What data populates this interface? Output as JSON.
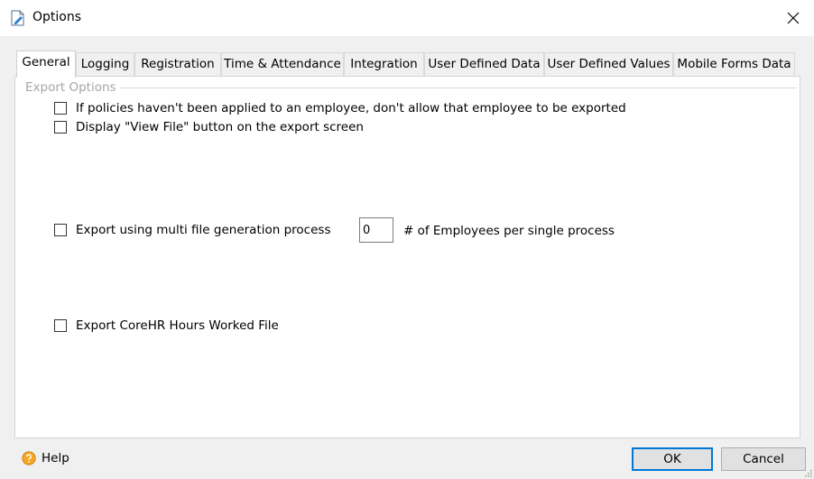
{
  "window": {
    "title": "Options"
  },
  "tabs": [
    {
      "label": "General",
      "active": true
    },
    {
      "label": "Logging"
    },
    {
      "label": "Registration"
    },
    {
      "label": "Time & Attendance"
    },
    {
      "label": "Integration"
    },
    {
      "label": "User Defined Data"
    },
    {
      "label": "User Defined Values"
    },
    {
      "label": "Mobile Forms Data"
    }
  ],
  "export_options": {
    "group_label": "Export Options",
    "no_policy_label": "If policies haven't been applied to an employee, don't allow that employee to be exported",
    "no_policy_checked": false,
    "view_file_label": "Display \"View File\" button on the export screen",
    "view_file_checked": false,
    "multi_file_label": "Export using multi file generation process",
    "multi_file_checked": false,
    "employees_per_process_value": "0",
    "employees_per_process_label": "# of Employees per single process",
    "corehr_label": "Export CoreHR Hours Worked File",
    "corehr_checked": false
  },
  "footer": {
    "help_label": "Help",
    "ok_label": "OK",
    "cancel_label": "Cancel"
  },
  "colors": {
    "accent": "#0078d7",
    "group_label": "#a6a6a6"
  },
  "icons": {
    "app": "document-edit-icon",
    "help": "help-icon",
    "close": "close-icon"
  }
}
